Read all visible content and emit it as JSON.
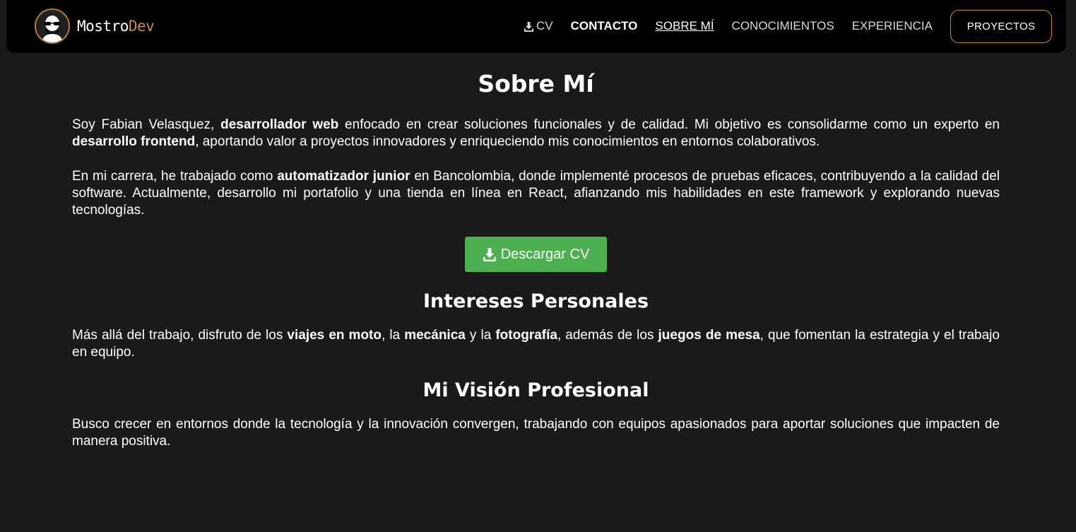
{
  "brand": {
    "name_main": "Mostro",
    "name_accent": "Dev"
  },
  "nav": {
    "cv_label": "CV",
    "contacto_label": "CONTACTO",
    "sobre_mi_label": "SOBRE MÍ",
    "conocimientos_label": "CONOCIMIENTOS",
    "experiencia_label": "EXPERIENCIA",
    "proyectos_label": "PROYECTOS"
  },
  "about": {
    "title": "Sobre Mí",
    "p1": {
      "t1": "Soy Fabian Velasquez, ",
      "b1": "desarrollador web",
      "t2": " enfocado en crear soluciones funcionales y de calidad. Mi objetivo es consolidarme como un experto en ",
      "b2": "desarrollo frontend",
      "t3": ", aportando valor a proyectos innovadores y enriqueciendo mis conocimientos en entornos colaborativos."
    },
    "p2": {
      "t1": "En mi carrera, he trabajado como ",
      "b1": "automatizador junior",
      "t2": " en Bancolombia, donde implementé procesos de pruebas eficaces, contribuyendo a la calidad del software. Actualmente, desarrollo mi portafolio y una tienda en línea en React, afianzando mis habilidades en este framework y explorando nuevas tecnologías."
    },
    "download_label": "Descargar CV"
  },
  "interests": {
    "title": "Intereses Personales",
    "t1": "Más allá del trabajo, disfruto de los ",
    "b1": "viajes en moto",
    "t2": ", la ",
    "b2": "mecánica",
    "t3": " y la ",
    "b3": "fotografía",
    "t4": ", además de los ",
    "b4": "juegos de mesa",
    "t5": ", que fomentan la estrategia y el trabajo en equipo."
  },
  "vision": {
    "title": "Mi Visión Profesional",
    "text": "Busco crecer en entornos donde la tecnología y la innovación convergen, trabajando con equipos apasionados para aportar soluciones que impacten de manera positiva."
  },
  "colors": {
    "accent": "#c98a3e",
    "download_button": "#4caf50",
    "background": "#1a1a1a",
    "navbar": "#000000"
  },
  "icons": [
    "avatar-logo-icon",
    "download-icon"
  ]
}
